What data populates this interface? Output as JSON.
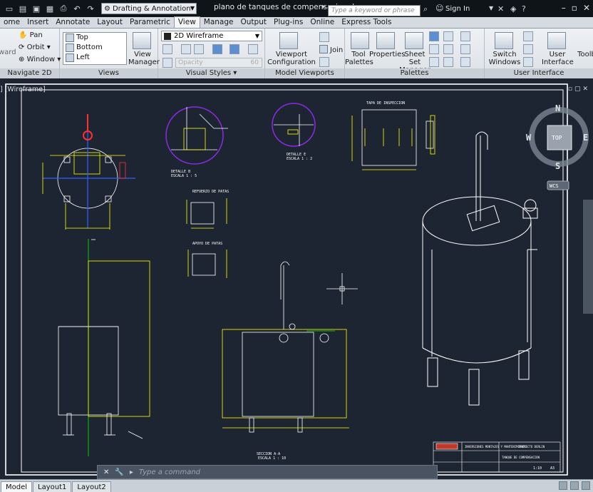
{
  "titlebar": {
    "workspace": "Drafting & Annotation",
    "document_title": "plano de tanques de compensacion.d...",
    "search_placeholder": "Type a keyword or phrase",
    "signin": "Sign In"
  },
  "ribbon_tabs": [
    "ome",
    "Insert",
    "Annotate",
    "Layout",
    "Parametric",
    "View",
    "Manage",
    "Output",
    "Plug-ins",
    "Online",
    "Express Tools"
  ],
  "ribbon": {
    "navigate": {
      "title": "Navigate 2D",
      "pan": "Pan",
      "orbit": "Orbit",
      "window": "Window",
      "rward": "ward"
    },
    "views": {
      "title": "Views",
      "items": [
        "Top",
        "Bottom",
        "Left"
      ],
      "view_manager": "View Manager"
    },
    "visual_styles": {
      "title": "Visual Styles",
      "current": "2D Wireframe",
      "opacity_label": "Opacity",
      "opacity_value": "60"
    },
    "model_viewports": {
      "title": "Model Viewports",
      "configuration": "Viewport Configuration",
      "join": "Join"
    },
    "palettes": {
      "title": "Palettes",
      "tool_palettes": "Tool Palettes",
      "properties": "Properties",
      "sheet_set": "Sheet Set Manager"
    },
    "user_interface": {
      "title": "User Interface",
      "switch_windows": "Switch Windows",
      "user_interface": "User Interface",
      "toolbars": "Toolb"
    }
  },
  "viewport": {
    "label": "] [Wireframe]",
    "viewcube": {
      "top": "TOP",
      "n": "N",
      "s": "S",
      "e": "E",
      "w": "W",
      "wcs": "WCS"
    },
    "drawing_labels": {
      "detalle_b": "DETALLE B",
      "detalle_b_scale": "ESCALA 1 : 5",
      "detalle_e": "DETALLE E",
      "detalle_e_scale": "ESCALA 1 : 2",
      "tapa": "TAPA DE INSPECCION",
      "refuerzo": "REFUERZO DE PATAS",
      "apoyo": "APOYO DE PATAS",
      "seccion": "SECCION A-A",
      "seccion_scale": "ESCALA 1 : 10",
      "company": "INVERSIONES MONTAJES Y MANTENIMIENTO",
      "project": "PROYECTO DERLIN",
      "sheet_title": "TANQUE DE COMPENSACION",
      "sheet_code": "1:10",
      "sheet_no": "A3"
    }
  },
  "command_line": {
    "placeholder": "Type a command"
  },
  "layout_tabs": [
    "Model",
    "Layout1",
    "Layout2"
  ]
}
